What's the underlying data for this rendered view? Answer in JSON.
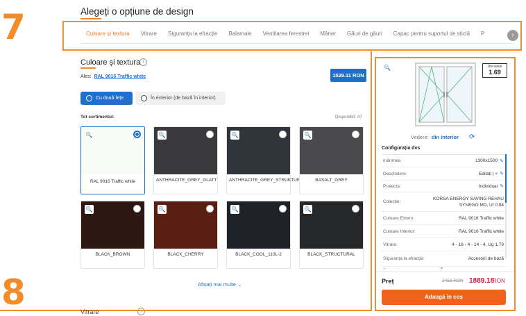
{
  "annotations": {
    "step_top": "7",
    "step_bottom": "8"
  },
  "page_title": "Alegeți o opțiune de design",
  "tabs": [
    {
      "label": "Culoare și textura",
      "active": true
    },
    {
      "label": "Vitrare"
    },
    {
      "label": "Siguranța la efracție"
    },
    {
      "label": "Balamale"
    },
    {
      "label": "Ventilarea ferestrei"
    },
    {
      "label": "Mâner"
    },
    {
      "label": "Găuri de găuri"
    },
    {
      "label": "Capac pentru suportul de sticlă"
    },
    {
      "label": "P"
    }
  ],
  "tabs_next_icon": "chevron-right-icon",
  "section": {
    "title": "Culoare și textura",
    "ales_label": "Ales:",
    "ales_value": "RAL 9016 Traffic white",
    "price_badge": "1529.11 RON",
    "toggle_both": "Cu două fețe",
    "toggle_exterior": "În exterior (de bază în interior)",
    "assortment_label": "Tot sortimentul:",
    "available": "Disponibil: 47",
    "show_more": "Afișați mai multe"
  },
  "swatches": [
    {
      "label": "RAL 9016 Traffic white",
      "color": "#f6fbf7",
      "selected": true
    },
    {
      "label": "ANTHRACITE_GREY_GLATT",
      "color": "#3a3a3c"
    },
    {
      "label": "ANTHRACITE_GREY_STRUKTURAL",
      "color": "#30343b"
    },
    {
      "label": "BASALT_GREY",
      "color": "#4a4a4c"
    },
    {
      "label": "BLACK_BROWN",
      "color": "#2d1712"
    },
    {
      "label": "BLACK_CHERRY",
      "color": "#5a1f12"
    },
    {
      "label": "BLACK_COOL_110L-2",
      "color": "#1f2329"
    },
    {
      "label": "BLACK_STRUCTURAL",
      "color": "#262729"
    }
  ],
  "next_section": "Vitrare",
  "preview": {
    "uw_label": "Uw-value",
    "uw_value": "1.69",
    "view_label": "Vedere:",
    "view_value": "din interior"
  },
  "config": {
    "title": "Configurația dvs",
    "rows": [
      {
        "key": "mărimea",
        "value": "1300x1500",
        "editable": true
      },
      {
        "key": "Deschidere:",
        "value": "Editați | ×",
        "editable": true
      },
      {
        "key": "Proiecta:",
        "value": "Individual",
        "editable": true
      },
      {
        "key": "Colecție:",
        "value": "KORSA ENERGY SAVING REHAU SYNEGO MD, Uf 0.94"
      },
      {
        "key": "Culoare Extern:",
        "value": "RAL 9016 Traffic white"
      },
      {
        "key": "Culoare Interior:",
        "value": "RAL 9016 Traffic white"
      },
      {
        "key": "Vitrare:",
        "value": "4 - 16 - 4 - 14 - 4, Ug 1.79"
      },
      {
        "key": "Siguranța la efracție:",
        "value": "Accesorii de bază"
      },
      {
        "key": "Balamale:",
        "value": ""
      }
    ]
  },
  "price": {
    "label": "Preț",
    "old": "2453 RON",
    "new": "1889.18",
    "currency": "RON"
  },
  "cart_button": "Adaugă în coș",
  "colors": {
    "accent": "#f28c28",
    "primary": "#1f6fd1",
    "cta": "#f0621e",
    "price": "#c81e3c"
  }
}
